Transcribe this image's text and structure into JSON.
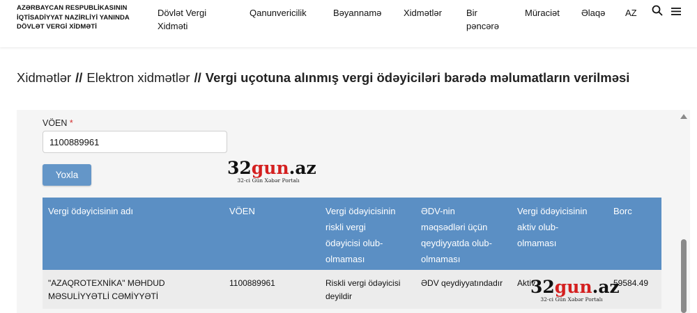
{
  "header": {
    "org_line1": "AZƏRBAYCAN RESPUBLİKASININ",
    "org_line2": "İQTİSADİYYAT NAZİRLİYİ YANINDA",
    "org_line3": "DÖVLƏT VERGİ XİDMƏTİ",
    "nav": [
      {
        "line1": "Dövlət Vergi",
        "line2": "Xidməti"
      },
      {
        "line1": "Qanunvericilik",
        "line2": ""
      },
      {
        "line1": "Bəyannamə",
        "line2": ""
      },
      {
        "line1": "Xidmətlər",
        "line2": ""
      },
      {
        "line1": "Bir",
        "line2": "pəncərə"
      },
      {
        "line1": "Müraciət",
        "line2": ""
      },
      {
        "line1": "Əlaqə",
        "line2": ""
      }
    ],
    "lang": "AZ",
    "icons": {
      "search": "search-icon",
      "menu": "hamburger-menu-icon"
    }
  },
  "breadcrumb": {
    "items": [
      "Xidmətlər",
      "Elektron xidmətlər"
    ],
    "separator": "//",
    "current": "Vergi uçotuna alınmış vergi ödəyiciləri barədə məlumatların verilməsi"
  },
  "form": {
    "voen_label": "VÖEN",
    "required_mark": "*",
    "voen_value": "1100889961",
    "submit_label": "Yoxla"
  },
  "watermark": {
    "logo_black": "32",
    "logo_red": "gun",
    "logo_suffix": ".az",
    "tagline": "32-ci Gün Xəbər Portalı"
  },
  "table": {
    "columns": [
      {
        "l1": "Vergi ödəyicisinin adı",
        "l2": "",
        "l3": "",
        "l4": ""
      },
      {
        "l1": "VÖEN",
        "l2": "",
        "l3": "",
        "l4": ""
      },
      {
        "l1": "Vergi ödəyicisinin",
        "l2": "riskli vergi",
        "l3": "ödəyicisi olub-",
        "l4": "olmaması"
      },
      {
        "l1": "ƏDV-nin",
        "l2": "məqsədləri üçün",
        "l3": "qeydiyyatda olub-",
        "l4": "olmaması"
      },
      {
        "l1": "Vergi ödəyicisinin",
        "l2": "aktiv olub-",
        "l3": "olmaması",
        "l4": ""
      },
      {
        "l1": "Borc",
        "l2": "",
        "l3": "",
        "l4": ""
      }
    ],
    "rows": [
      {
        "name_l1": "\"AZAQROTEXNİKA\" MƏHDUD",
        "name_l2": "MƏSULİYYƏTLİ CƏMİYYƏTİ",
        "voen": "1100889961",
        "risk_l1": "Riskli vergi ödəyicisi",
        "risk_l2": "deyildir",
        "vat": "ƏDV qeydiyyatındadır",
        "active": "Aktiv",
        "debt": "59584.49"
      }
    ]
  },
  "colors": {
    "table_header": "#5b8fc4",
    "button": "#6496c8",
    "required": "#d32f2f",
    "watermark_red": "#d42020"
  }
}
